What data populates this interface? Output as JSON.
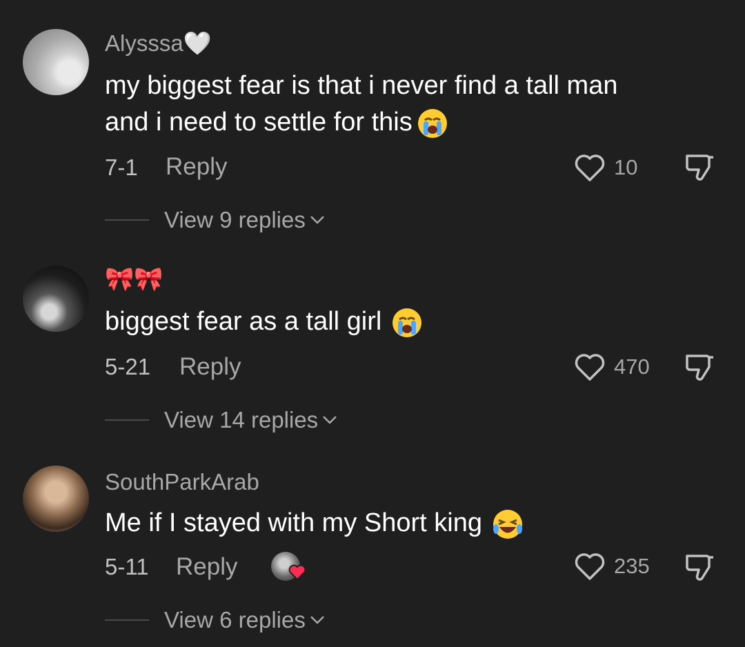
{
  "comments": [
    {
      "username": "Alysssa",
      "username_suffix": "🤍",
      "text_lines": [
        "my biggest fear is that i never find a tall man",
        "and i need to settle for this"
      ],
      "emoji": "😭",
      "date": "7-1",
      "reply_label": "Reply",
      "likes": "10",
      "view_replies": "View 9 replies"
    },
    {
      "username": "🎀🎀",
      "text_lines": [
        "biggest fear as a tall girl"
      ],
      "emoji": "😭",
      "date": "5-21",
      "reply_label": "Reply",
      "likes": "470",
      "view_replies": "View 14 replies"
    },
    {
      "username": "SouthParkArab",
      "text_lines": [
        "Me if I stayed with my Short king"
      ],
      "emoji": "😂",
      "date": "5-11",
      "reply_label": "Reply",
      "likes": "235",
      "view_replies": "View 6 replies",
      "creator_liked": true
    }
  ],
  "colors": {
    "background": "#1f1f1f",
    "primary_text": "#ffffff",
    "secondary_text": "#a8a8a8",
    "liked_heart": "#fe2c55"
  },
  "icons": [
    "heart-outline-icon",
    "thumbs-down-icon",
    "chevron-down-icon",
    "crying-emoji-icon",
    "laughing-emoji-icon"
  ]
}
